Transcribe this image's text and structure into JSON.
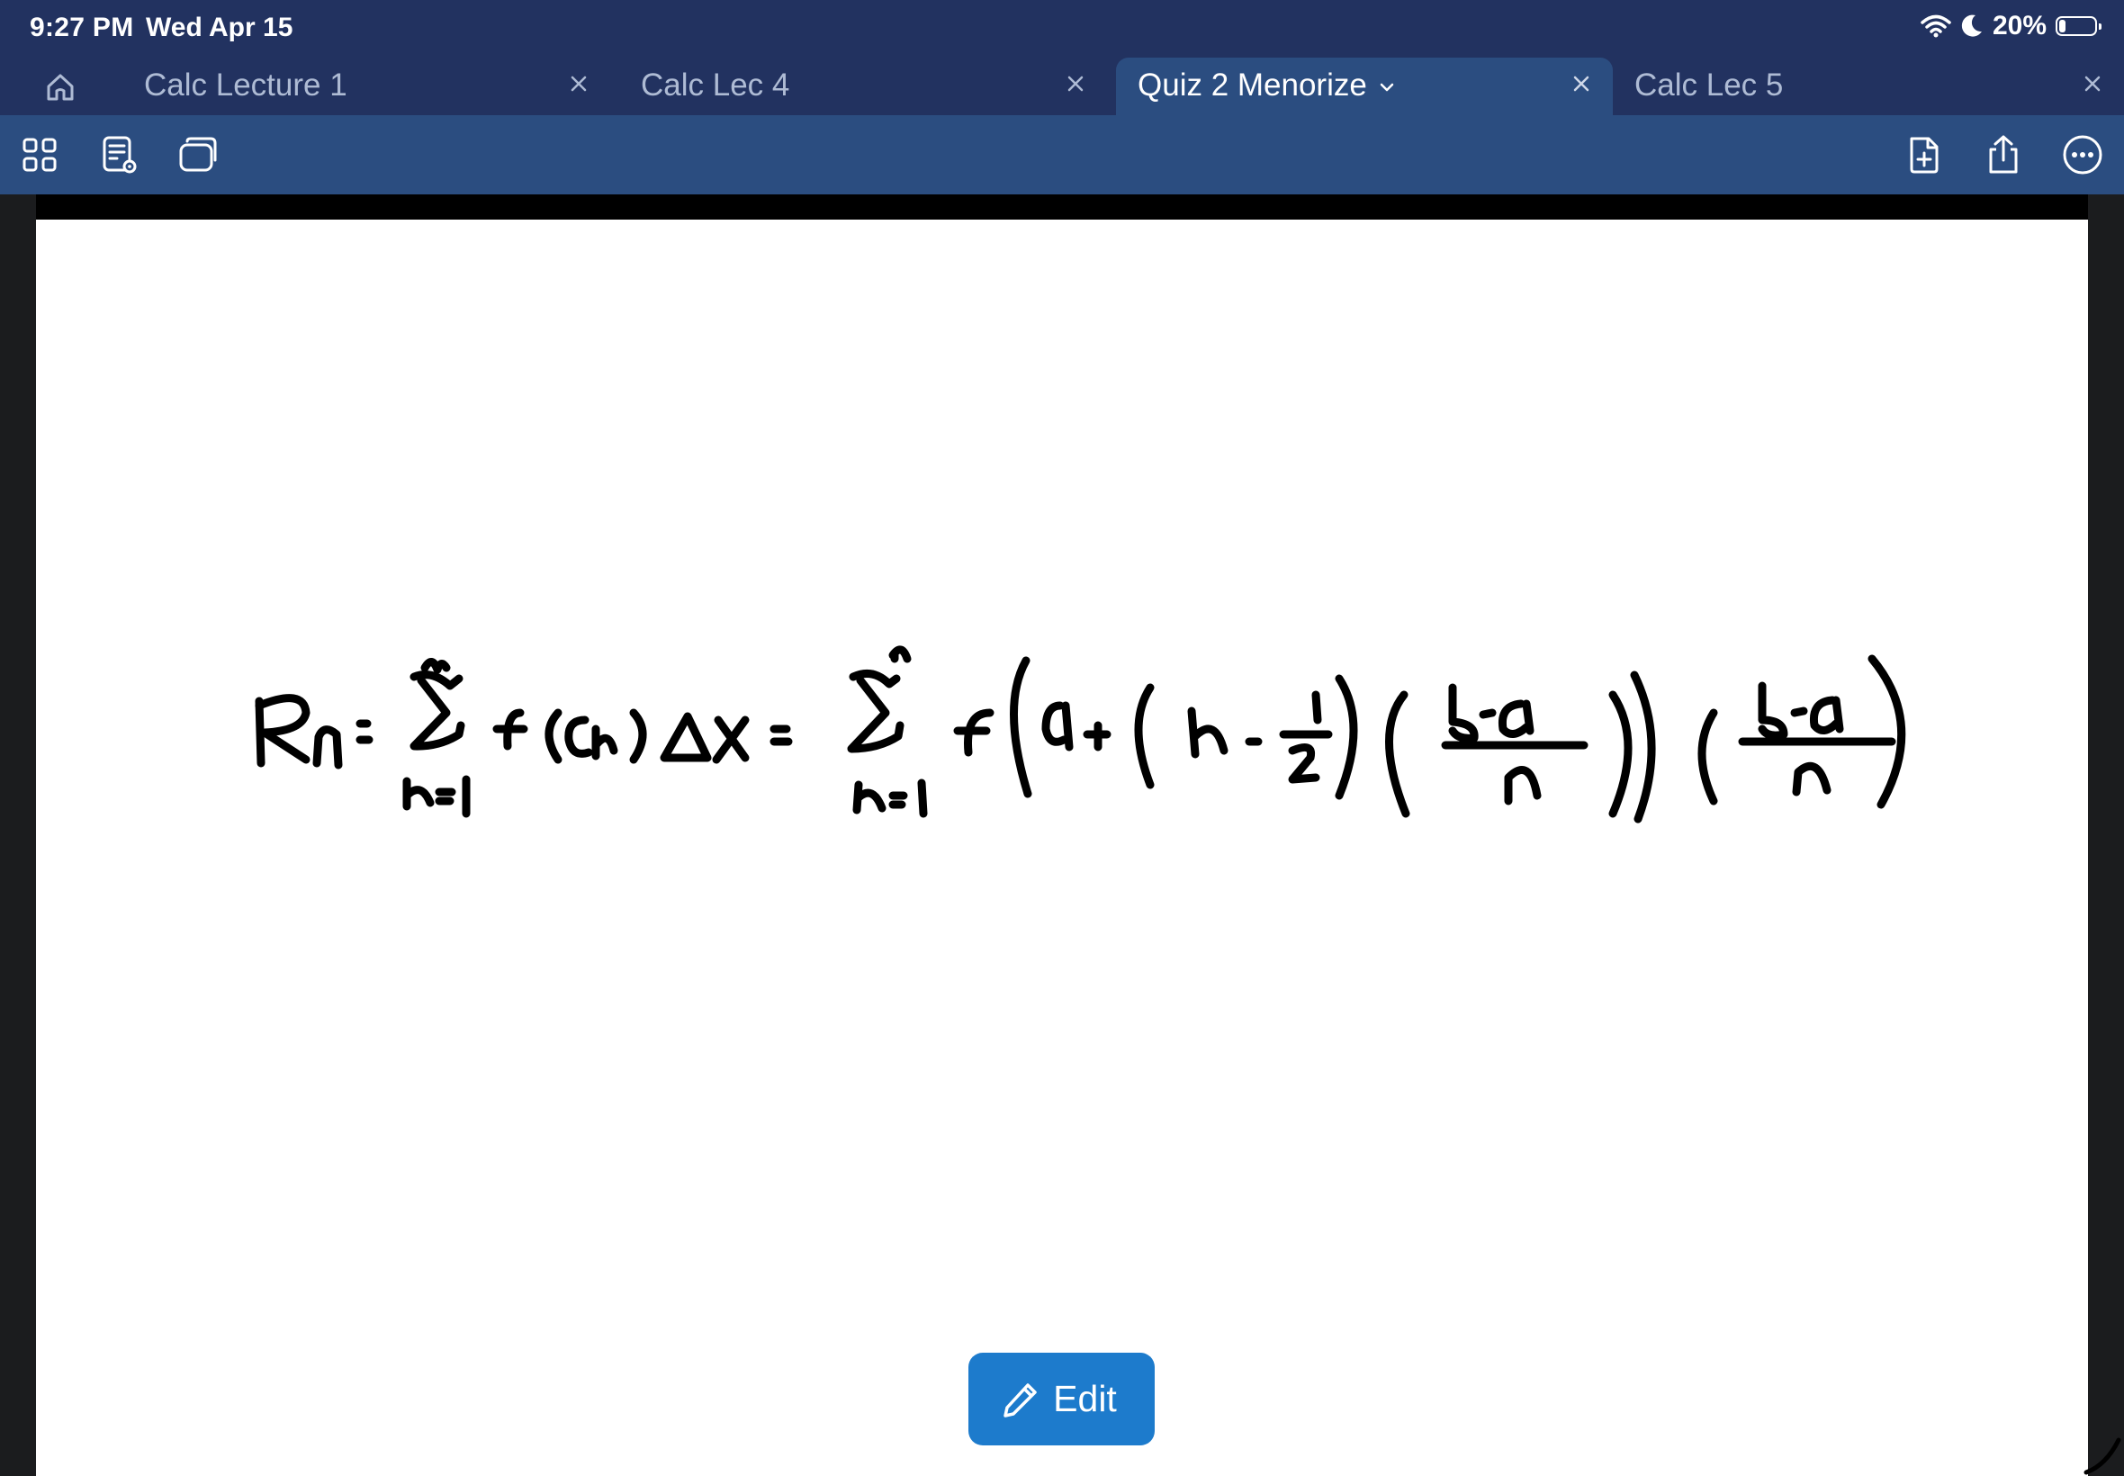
{
  "status_bar": {
    "time": "9:27 PM",
    "date": "Wed Apr 15",
    "battery_percent": "20%",
    "battery_level": 0.2,
    "icons": [
      "wifi-icon",
      "moon-icon",
      "battery-icon"
    ]
  },
  "tabs": [
    {
      "label": "Calc Lecture 1",
      "active": false
    },
    {
      "label": "Calc Lec 4",
      "active": false
    },
    {
      "label": "Quiz 2 Menorize",
      "active": true
    },
    {
      "label": "Calc Lec 5",
      "active": false
    }
  ],
  "toolbar": {
    "left_icons": [
      "grid-view-icon",
      "note-view-icon",
      "stack-icon"
    ],
    "right_icons": [
      "add-page-icon",
      "share-icon",
      "more-icon"
    ]
  },
  "edit_button": {
    "label": "Edit",
    "icon": "pencil-icon"
  },
  "accent_colors": {
    "topbar": "#223260",
    "toolbar": "#2b4d80",
    "edit": "#1d7bcc"
  }
}
